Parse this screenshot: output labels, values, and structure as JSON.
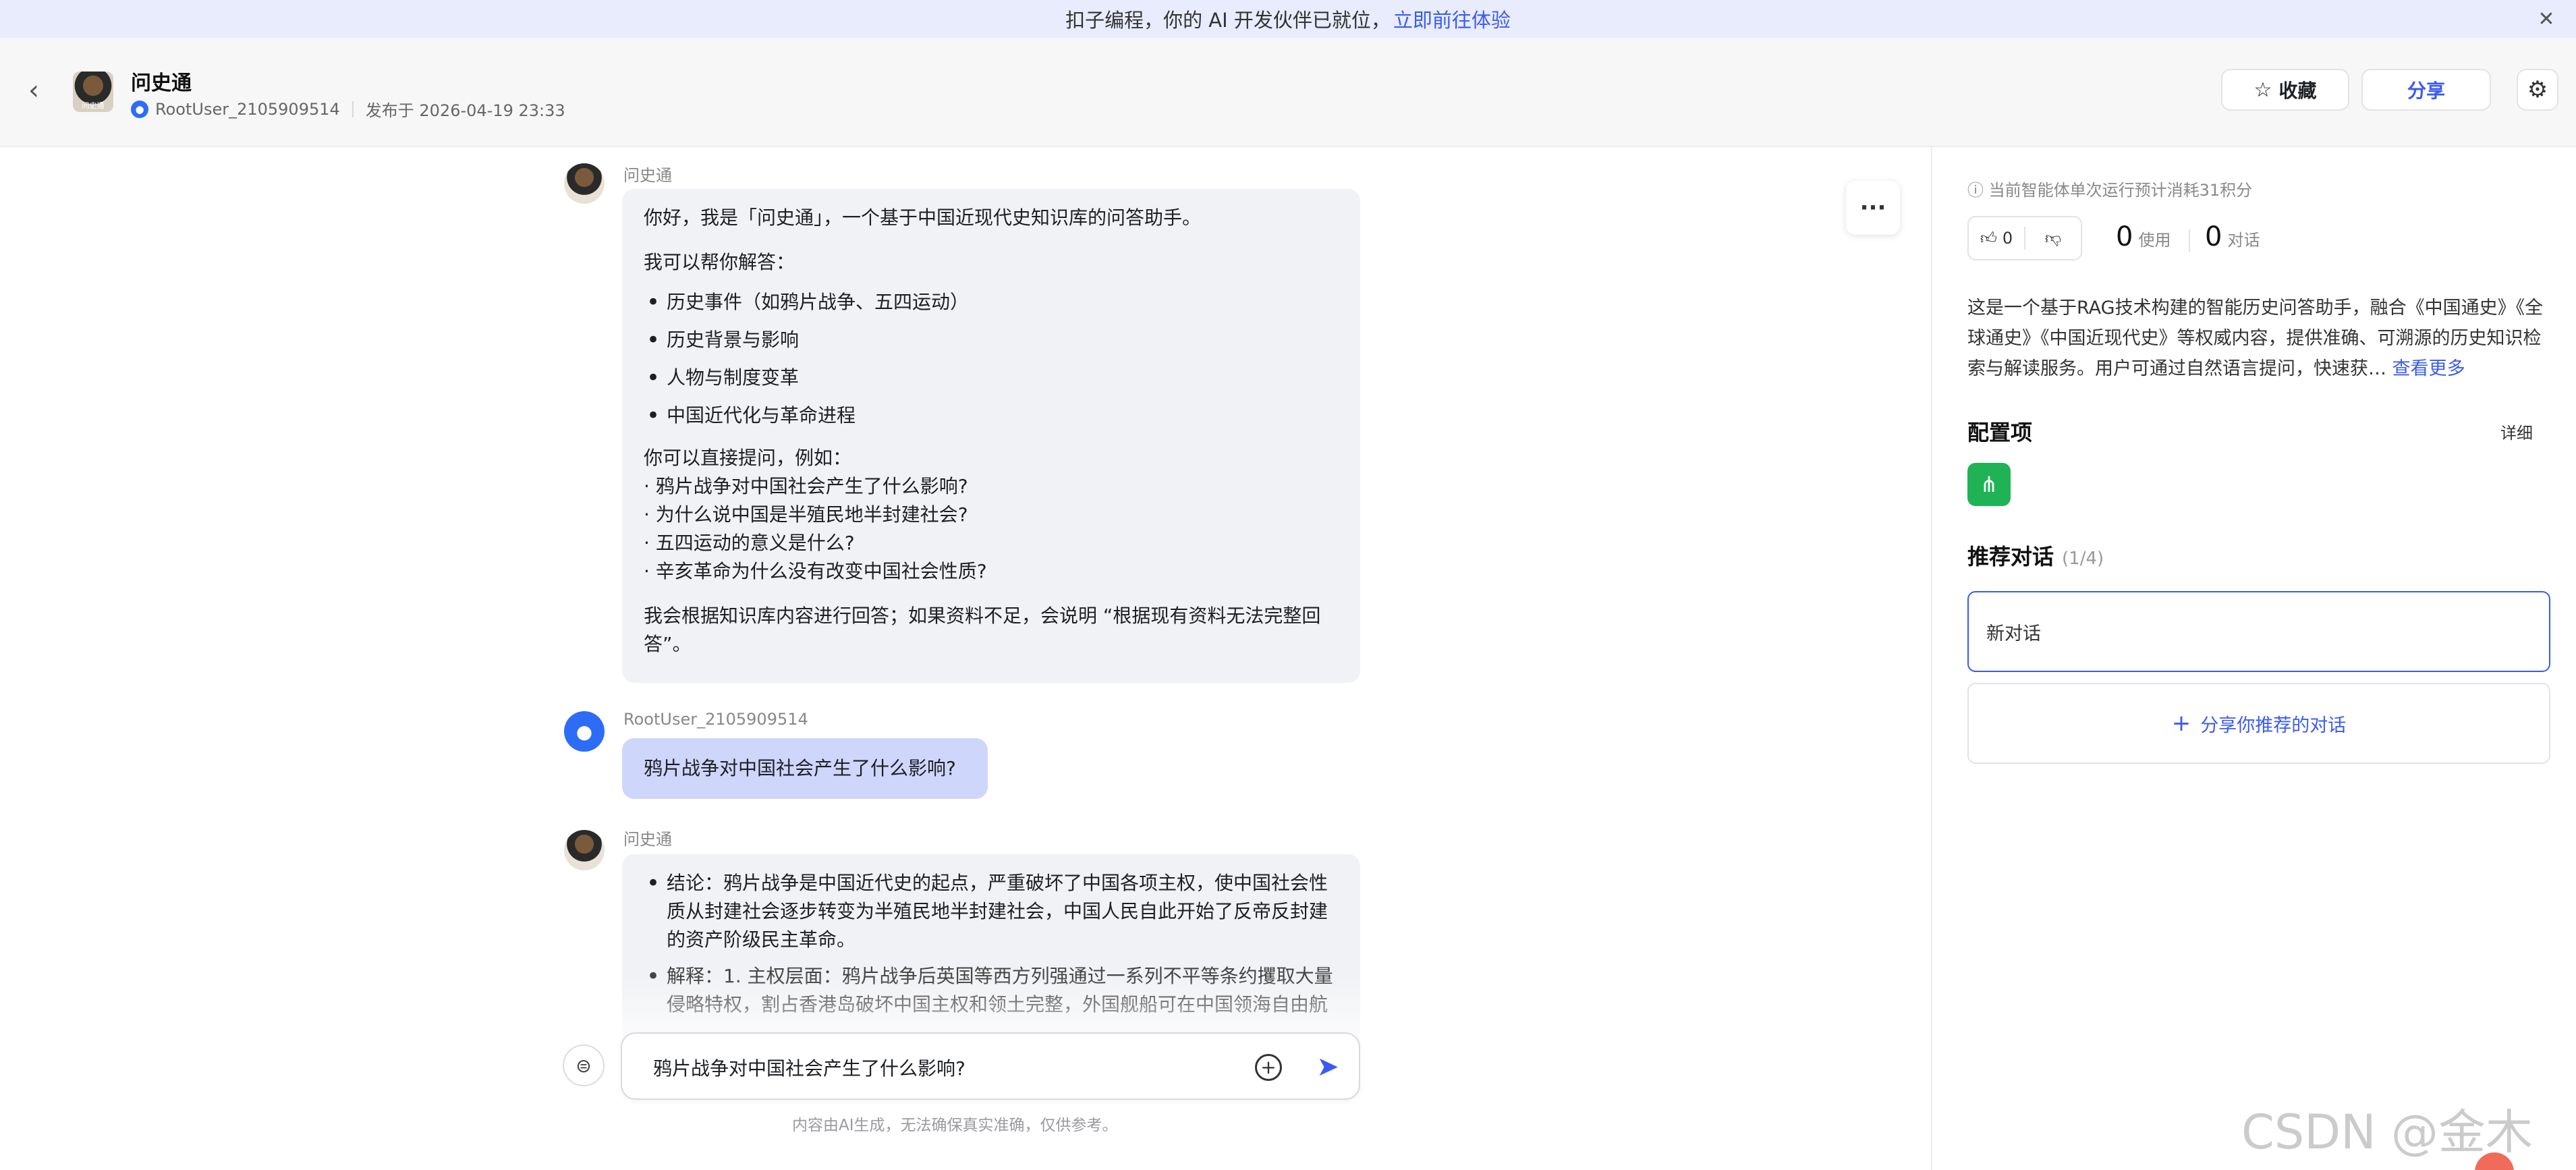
{
  "banner": {
    "text": "扣子编程，你的 AI 开发伙伴已就位，",
    "link": "立即前往体验",
    "close_icon": "close-icon"
  },
  "header": {
    "title": "问史通",
    "avatar_text": "问史通",
    "author": "RootUser_2105909514",
    "published": "发布于 2026-04-19 23:33",
    "favorite_label": "收藏",
    "share_label": "分享",
    "icons": [
      "back-arrow-icon",
      "star-icon",
      "gear-icon"
    ]
  },
  "chat": {
    "messages": [
      {
        "sender": "问史通",
        "role": "bot",
        "intro": "你好，我是「问史通」，一个基于中国近现代史知识库的问答助手。",
        "can_help": "我可以帮你解答：",
        "topics": [
          "历史事件（如鸦片战争、五四运动）",
          "历史背景与影响",
          "人物与制度变革",
          "中国近代化与革命进程"
        ],
        "example_intro": "你可以直接提问，例如：",
        "examples": [
          "· 鸦片战争对中国社会产生了什么影响?",
          "· 为什么说中国是半殖民地半封建社会?",
          "· 五四运动的意义是什么?",
          "· 辛亥革命为什么没有改变中国社会性质?"
        ],
        "closing": "我会根据知识库内容进行回答；如果资料不足，会说明 “根据现有资料无法完整回答”。"
      },
      {
        "sender": "RootUser_2105909514",
        "role": "user",
        "text": "鸦片战争对中国社会产生了什么影响?"
      },
      {
        "sender": "问史通",
        "role": "bot",
        "conclusion": "结论：鸦片战争是中国近代史的起点，严重破坏了中国各项主权，使中国社会性质从封建社会逐步转变为半殖民地半封建社会，中国人民自此开始了反帝反封建的资产阶级民主革命。",
        "explanation": "解释：1. 主权层面：鸦片战争后英国等西方列强通过一系列不平等条约攫取大量侵略特权，割占香港岛破坏中国主权和领土完整，外国舰船可在中国领海自由航"
      }
    ],
    "input_value": "鸦片战争对中国社会产生了什么影响?",
    "disclaimer": "内容由AI生成，无法确保真实准确，仅供参考。"
  },
  "panel": {
    "cost": "当前智能体单次运行预计消耗31积分",
    "likes": "0",
    "uses_num": "0",
    "uses_label": "使用",
    "convs_num": "0",
    "convs_label": "对话",
    "description": "这是一个基于RAG技术构建的智能历史问答助手，融合《中国通史》《全球通史》《中国近现代史》等权威内容，提供准确、可溯源的历史知识检索与解读服务。用户可通过自然语言提问，快速获…",
    "see_more": "查看更多",
    "config_title": "配置项",
    "config_detail": "详细",
    "recommend_title": "推荐对话",
    "recommend_count": "(1/4)",
    "recommend_item": "新对话",
    "share_recommend": "分享你推荐的对话"
  },
  "watermark": "CSDN @金木AI",
  "colors": {
    "accent": "#3a5bf0",
    "user_bubble": "#cfd6fb",
    "bot_bubble": "#f1f2f5",
    "config_icon": "#1fb356"
  }
}
